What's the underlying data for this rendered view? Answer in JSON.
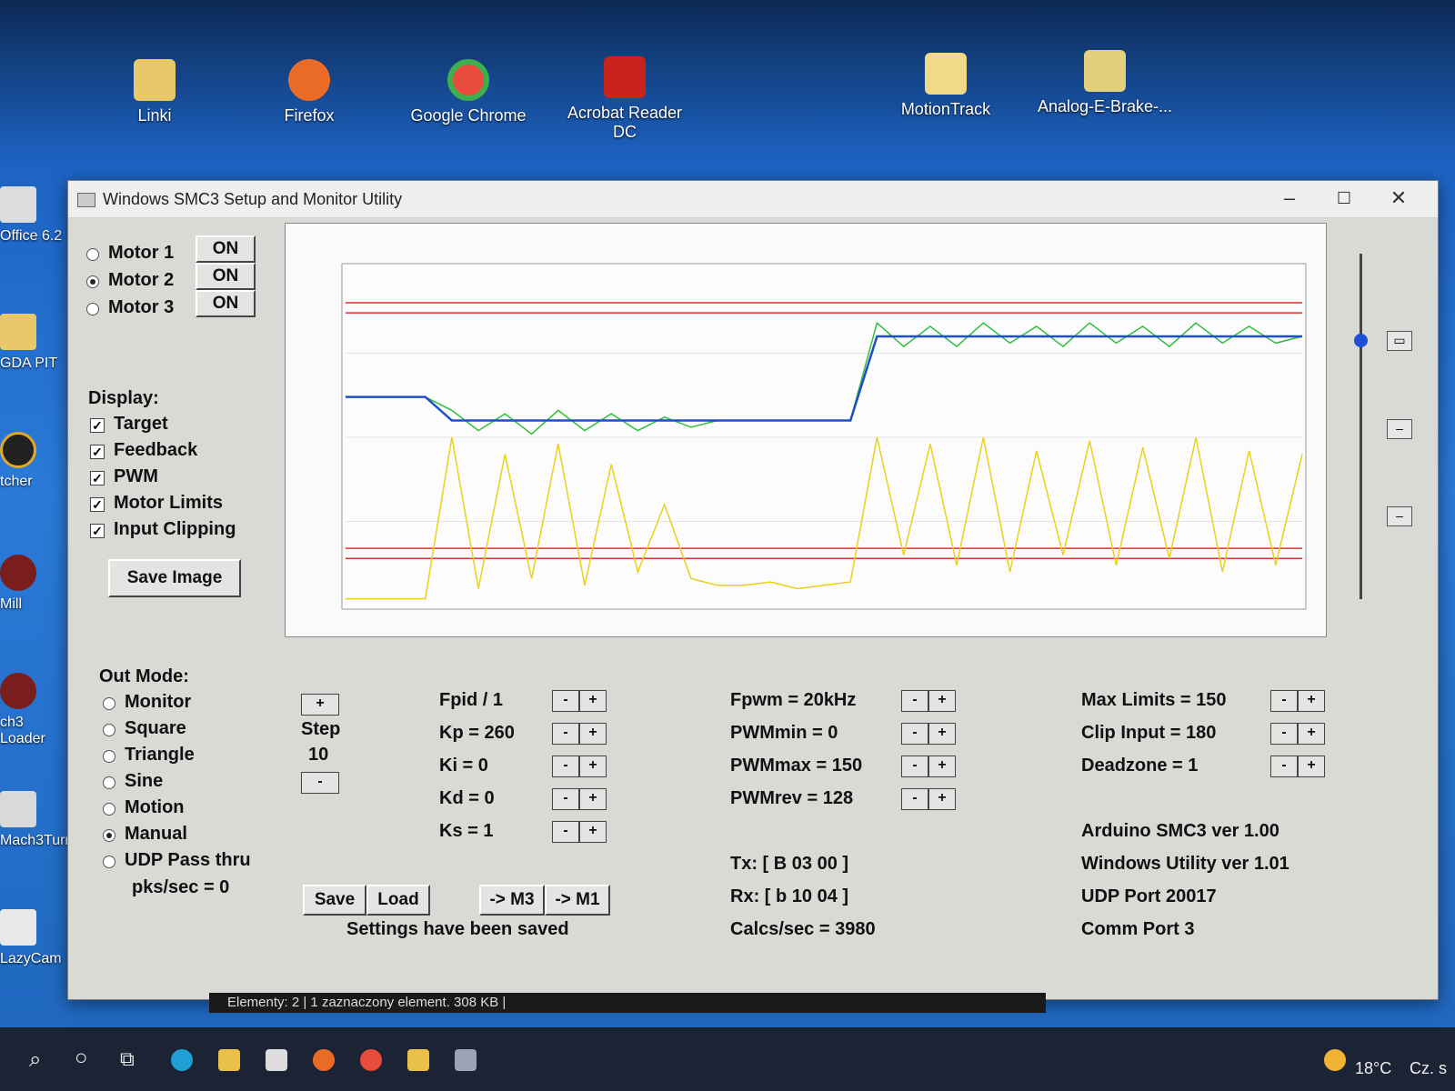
{
  "desktop": {
    "icons": [
      {
        "label": "Linki"
      },
      {
        "label": "Firefox"
      },
      {
        "label": "Google Chrome"
      },
      {
        "label": "Acrobat Reader DC"
      },
      {
        "label": "MotionTrack"
      },
      {
        "label": "Analog-E-Brake-..."
      }
    ],
    "left_icons": [
      {
        "label": "Office 6.2"
      },
      {
        "label": "GDA PIT"
      },
      {
        "label": "tcher"
      },
      {
        "label": "Mill"
      },
      {
        "label": "ch3 Loader"
      },
      {
        "label": "Mach3Turn"
      },
      {
        "label": "LazyCam"
      }
    ]
  },
  "window": {
    "title": "Windows SMC3 Setup and Monitor Utility",
    "controls": {
      "minimize": "–",
      "maximize": "☐",
      "close": "✕"
    }
  },
  "motors": [
    {
      "label": "Motor 1",
      "selected": false,
      "button": "ON"
    },
    {
      "label": "Motor 2",
      "selected": true,
      "button": "ON"
    },
    {
      "label": "Motor 3",
      "selected": false,
      "button": "ON"
    }
  ],
  "display": {
    "heading": "Display:",
    "options": [
      {
        "label": "Target",
        "checked": true
      },
      {
        "label": "Feedback",
        "checked": true
      },
      {
        "label": "PWM",
        "checked": true
      },
      {
        "label": "Motor Limits",
        "checked": true
      },
      {
        "label": "Input Clipping",
        "checked": true
      }
    ],
    "save_image": "Save Image"
  },
  "out_mode": {
    "heading": "Out Mode:",
    "options": [
      {
        "label": "Monitor",
        "selected": false
      },
      {
        "label": "Square",
        "selected": false
      },
      {
        "label": "Triangle",
        "selected": false
      },
      {
        "label": "Sine",
        "selected": false
      },
      {
        "label": "Motion",
        "selected": false
      },
      {
        "label": "Manual",
        "selected": true
      },
      {
        "label": "UDP Pass thru",
        "selected": false
      }
    ],
    "pks": "pks/sec = 0"
  },
  "step": {
    "plus": "+",
    "label": "Step",
    "value": "10",
    "minus": "-"
  },
  "pid_params": [
    {
      "label": "Fpid / 1"
    },
    {
      "label": "Kp = 260"
    },
    {
      "label": "Ki = 0"
    },
    {
      "label": "Kd = 0"
    },
    {
      "label": "Ks = 1"
    }
  ],
  "pwm_params": [
    {
      "label": "Fpwm = 20kHz"
    },
    {
      "label": "PWMmin = 0"
    },
    {
      "label": "PWMmax = 150"
    },
    {
      "label": "PWMrev = 128"
    }
  ],
  "limit_params": [
    {
      "label": "Max Limits = 150"
    },
    {
      "label": "Clip Input = 180"
    },
    {
      "label": "Deadzone = 1"
    }
  ],
  "buttons": {
    "save": "Save",
    "load": "Load",
    "to_m3": "-> M3",
    "to_m1": "-> M1",
    "minus": "-",
    "plus": "+"
  },
  "status_message": "Settings have been saved",
  "comms": {
    "tx": "Tx: [ B 03 00 ]",
    "rx": "Rx: [ b 10 04 ]",
    "calcs": "Calcs/sec = 3980"
  },
  "info": {
    "arduino": "Arduino SMC3 ver 1.00",
    "utility": "Windows Utility ver 1.01",
    "udp": "UDP Port 20017",
    "comm": "Comm Port 3"
  },
  "explorer_status": "Elementy: 2  |  1 zaznaczony element. 308 KB  |",
  "taskbar": {
    "temperature": "18°C",
    "day": "Cz. s"
  },
  "chart_data": {
    "type": "line",
    "title": "",
    "xlabel": "",
    "ylabel": "",
    "series": [
      {
        "color": "#1f4fc8",
        "values": [
          0.62,
          0.62,
          0.62,
          0.62,
          0.55,
          0.55,
          0.55,
          0.55,
          0.55,
          0.55,
          0.55,
          0.55,
          0.55,
          0.55,
          0.55,
          0.55,
          0.55,
          0.55,
          0.55,
          0.55,
          0.8,
          0.8,
          0.8,
          0.8,
          0.8,
          0.8,
          0.8,
          0.8,
          0.8,
          0.8,
          0.8,
          0.8,
          0.8,
          0.8,
          0.8,
          0.8,
          0.8
        ]
      },
      {
        "color": "#2fbf3a",
        "values": [
          0.62,
          0.62,
          0.62,
          0.62,
          0.58,
          0.52,
          0.57,
          0.51,
          0.58,
          0.52,
          0.57,
          0.52,
          0.56,
          0.53,
          0.55,
          0.55,
          0.55,
          0.55,
          0.55,
          0.55,
          0.84,
          0.77,
          0.83,
          0.77,
          0.84,
          0.78,
          0.83,
          0.77,
          0.84,
          0.78,
          0.83,
          0.77,
          0.84,
          0.78,
          0.83,
          0.78,
          0.8
        ]
      },
      {
        "color": "#e8d21a",
        "values": [
          0.02,
          0.02,
          0.02,
          0.02,
          0.5,
          0.05,
          0.45,
          0.08,
          0.48,
          0.06,
          0.42,
          0.1,
          0.3,
          0.08,
          0.06,
          0.06,
          0.07,
          0.05,
          0.06,
          0.07,
          0.5,
          0.15,
          0.48,
          0.12,
          0.5,
          0.1,
          0.46,
          0.15,
          0.49,
          0.12,
          0.47,
          0.14,
          0.5,
          0.1,
          0.46,
          0.12,
          0.45
        ]
      }
    ],
    "limits": [
      {
        "color": "#e03030",
        "y": 0.9
      },
      {
        "color": "#e03030",
        "y": 0.87
      },
      {
        "color": "#e03030",
        "y": 0.17
      },
      {
        "color": "#e03030",
        "y": 0.14
      }
    ],
    "ylim": [
      0,
      1
    ]
  }
}
